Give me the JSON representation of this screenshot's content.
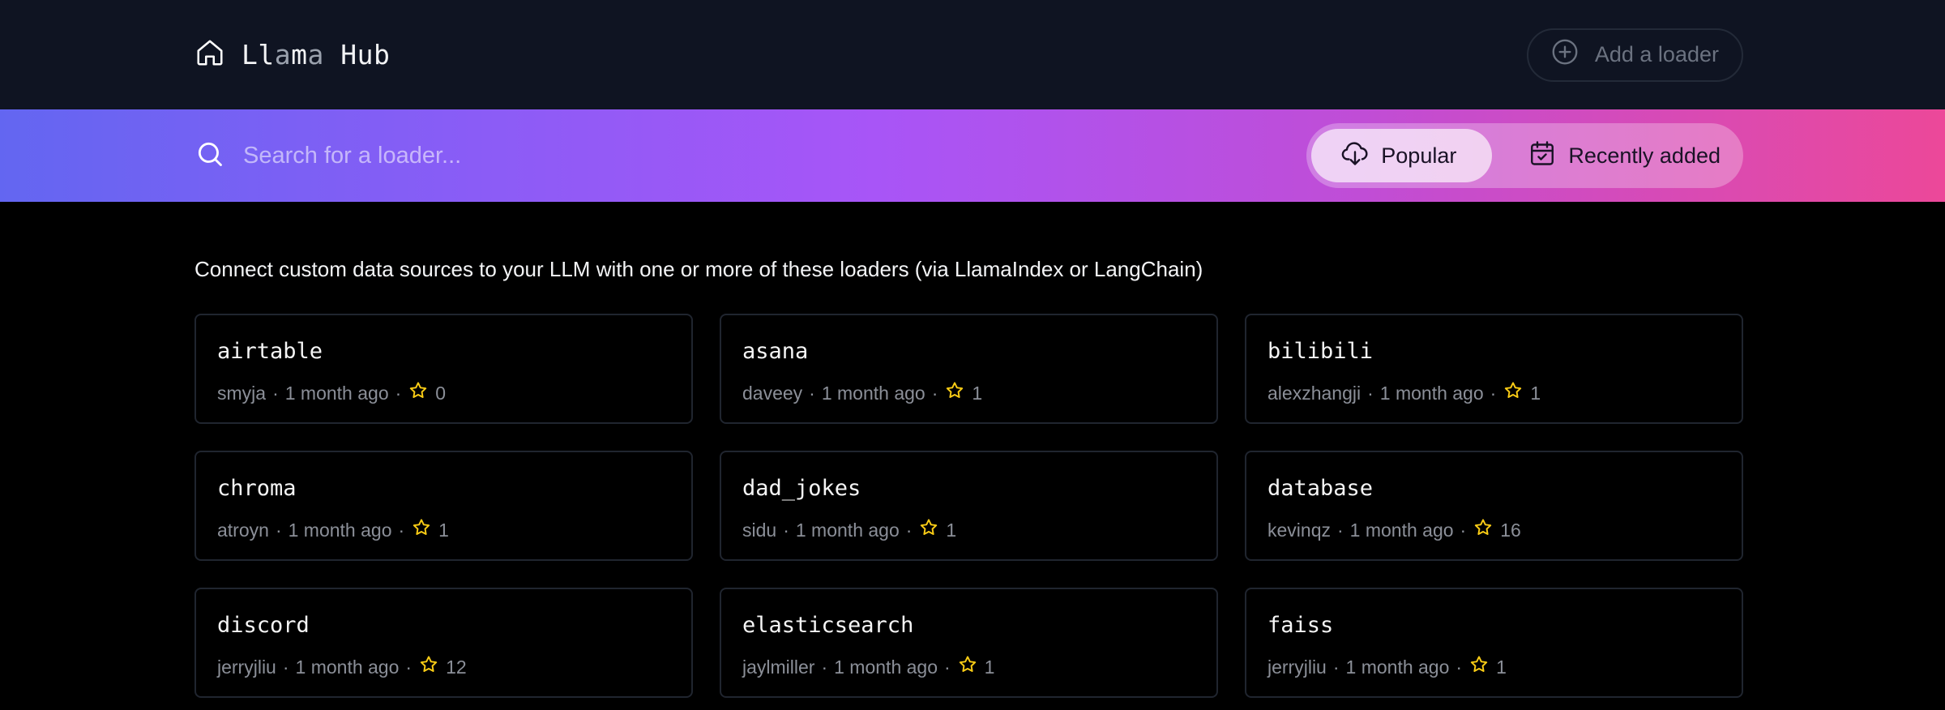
{
  "header": {
    "title_parts": [
      "Ll",
      "a",
      "m",
      "a",
      " Hub"
    ],
    "add_loader_label": "Add a loader"
  },
  "search": {
    "placeholder": "Search for a loader..."
  },
  "sort": {
    "popular_label": "Popular",
    "recent_label": "Recently added",
    "active": "popular"
  },
  "intro_text": "Connect custom data sources to your LLM with one or more of these loaders (via LlamaIndex or LangChain)",
  "colors": {
    "star": "#facc15",
    "gradient_start": "#6366f1",
    "gradient_end": "#ec4899"
  },
  "loaders": [
    {
      "name": "airtable",
      "author": "smyja",
      "updated": "1 month ago",
      "stars": "0"
    },
    {
      "name": "asana",
      "author": "daveey",
      "updated": "1 month ago",
      "stars": "1"
    },
    {
      "name": "bilibili",
      "author": "alexzhangji",
      "updated": "1 month ago",
      "stars": "1"
    },
    {
      "name": "chroma",
      "author": "atroyn",
      "updated": "1 month ago",
      "stars": "1"
    },
    {
      "name": "dad_jokes",
      "author": "sidu",
      "updated": "1 month ago",
      "stars": "1"
    },
    {
      "name": "database",
      "author": "kevinqz",
      "updated": "1 month ago",
      "stars": "16"
    },
    {
      "name": "discord",
      "author": "jerryjliu",
      "updated": "1 month ago",
      "stars": "12"
    },
    {
      "name": "elasticsearch",
      "author": "jaylmiller",
      "updated": "1 month ago",
      "stars": "1"
    },
    {
      "name": "faiss",
      "author": "jerryjliu",
      "updated": "1 month ago",
      "stars": "1"
    }
  ]
}
